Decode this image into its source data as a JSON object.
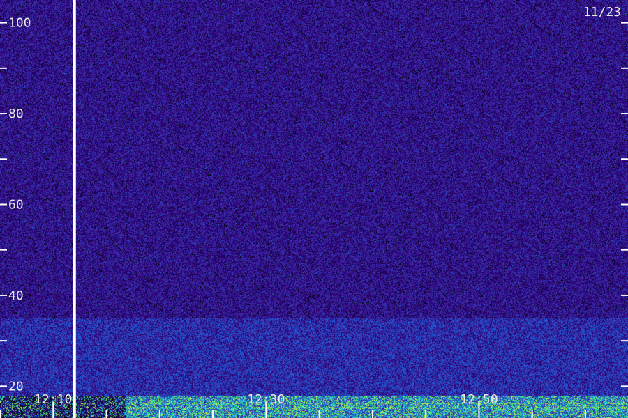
{
  "chart_data": {
    "type": "heatmap",
    "title": "",
    "date_label": "11/23",
    "xlabel": "",
    "ylabel": "",
    "y_axis": {
      "min": 13,
      "max": 105,
      "labeled_ticks": [
        20,
        40,
        60,
        80,
        100
      ],
      "minor_step": 10
    },
    "x_axis": {
      "start": "12:05",
      "end": "12:64",
      "labeled_ticks": [
        {
          "minute": 10,
          "label": "12:10"
        },
        {
          "minute": 30,
          "label": "12:30"
        },
        {
          "minute": 50,
          "label": "12:50"
        }
      ],
      "minor_step_minutes": 5
    },
    "marker_line_minute": 12,
    "colormap": [
      "#000000",
      "#2a0070",
      "#3a2aa8",
      "#1f5cd6",
      "#15b4e0",
      "#3de87a",
      "#c8ff40"
    ],
    "intensity_profile": [
      {
        "range": [
          13,
          18
        ],
        "level": 0.75
      },
      {
        "range": [
          18,
          35
        ],
        "level": 0.45
      },
      {
        "range": [
          35,
          105
        ],
        "level": 0.35
      }
    ]
  }
}
